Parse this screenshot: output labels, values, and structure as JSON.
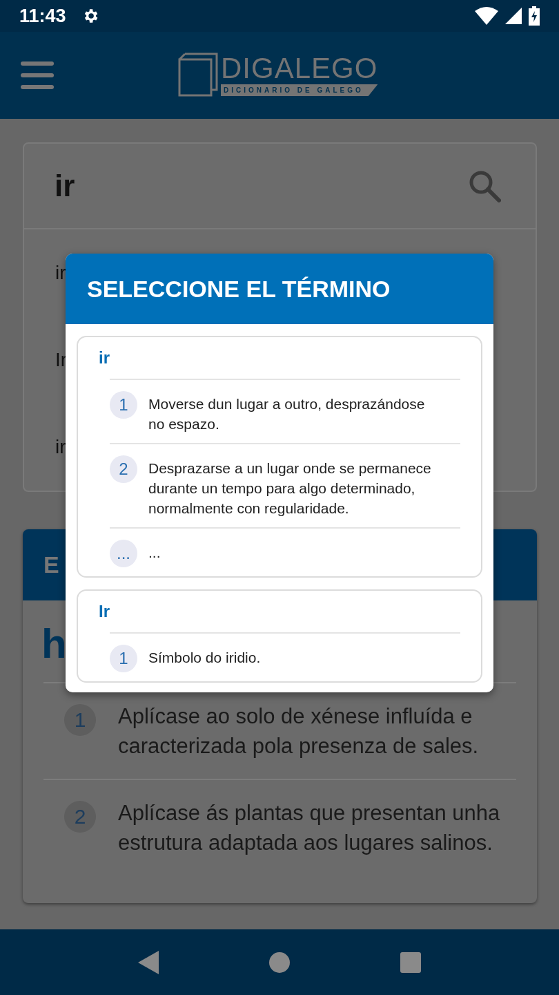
{
  "status_bar": {
    "time": "11:43"
  },
  "app_bar": {
    "logo_title": "DIGALEGO",
    "logo_subtitle": "DICIONARIO DE GALEGO"
  },
  "search": {
    "value": "ir",
    "suggestions": [
      "ir",
      "Ir",
      "ir"
    ]
  },
  "entry": {
    "header": "E",
    "headword": "h",
    "senses": [
      {
        "number": "1",
        "text": "Aplícase ao solo de xénese influída e caracterizada pola presenza de sales."
      },
      {
        "number": "2",
        "text": "Aplícase ás plantas que presentan unha estrutura adaptada aos lugares salinos."
      }
    ]
  },
  "dialog": {
    "title": "SELECCIONE EL TÉRMINO",
    "terms": [
      {
        "term": "ir",
        "senses": [
          {
            "number": "1",
            "text": "Moverse dun lugar a outro, desprazándose no espazo."
          },
          {
            "number": "2",
            "text": "Desprazarse a un lugar onde se permanece durante un tempo para algo determinado, normalmente con regularidade."
          },
          {
            "number": "...",
            "text": "..."
          }
        ]
      },
      {
        "term": "Ir",
        "senses": [
          {
            "number": "1",
            "text": "Símbolo do iridio."
          }
        ]
      }
    ]
  }
}
